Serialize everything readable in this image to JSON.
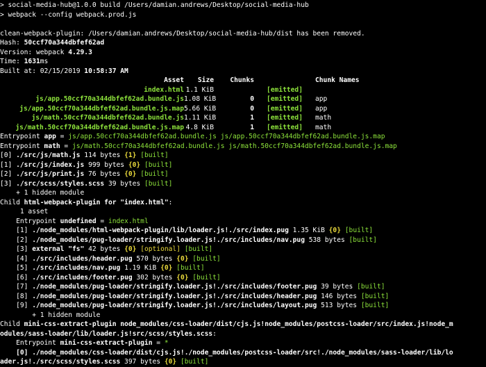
{
  "colors": {
    "background": "#000000",
    "text": "#ffffff",
    "green": "#8de33b",
    "yellow": "#e8d83b"
  },
  "header": [
    "> social-media-hub@1.0.0 build /Users/damian.andrews/Desktop/social-media-hub",
    "> webpack --config webpack.prod.js"
  ],
  "clean_line": "clean-webpack-plugin: /Users/damian.andrews/Desktop/social-media-hub/dist has been removed.",
  "hash_label": "Hash: ",
  "hash": "50ccf70a344dbfef62ad",
  "version_label": "Version: webpack ",
  "version": "4.29.3",
  "time_label": "Time: ",
  "time": "1631",
  "time_unit": "ms",
  "built_label": "Built at: 02/15/2019 ",
  "built_time": "10:58:37 AM",
  "table": {
    "headers": [
      "Asset",
      "Size",
      "Chunks",
      "",
      "Chunk Names"
    ],
    "rows": [
      {
        "asset": "index.html",
        "size": "1.1 KiB",
        "chunks": "",
        "status": "[emitted]",
        "name": ""
      },
      {
        "asset": "js/app.50ccf70a344dbfef62ad.bundle.js",
        "size": "1.08 KiB",
        "chunks": "0",
        "status": "[emitted]",
        "name": "app"
      },
      {
        "asset": "js/app.50ccf70a344dbfef62ad.bundle.js.map",
        "size": "5.66 KiB",
        "chunks": "0",
        "status": "[emitted]",
        "name": "app"
      },
      {
        "asset": "js/math.50ccf70a344dbfef62ad.bundle.js",
        "size": "1.11 KiB",
        "chunks": "1",
        "status": "[emitted]",
        "name": "math"
      },
      {
        "asset": "js/math.50ccf70a344dbfef62ad.bundle.js.map",
        "size": "4.8 KiB",
        "chunks": "1",
        "status": "[emitted]",
        "name": "math"
      }
    ]
  },
  "entrypoints": [
    {
      "label": "Entrypoint ",
      "name": "app",
      "eq": " = ",
      "files": "js/app.50ccf70a344dbfef62ad.bundle.js js/app.50ccf70a344dbfef62ad.bundle.js.map"
    },
    {
      "label": "Entrypoint ",
      "name": "math",
      "eq": " = ",
      "files": "js/math.50ccf70a344dbfef62ad.bundle.js js/math.50ccf70a344dbfef62ad.bundle.js.map"
    }
  ],
  "modules": [
    {
      "id": "[0] ",
      "path": "./src/js/math.js",
      "info": " 114 bytes ",
      "chunk": "{1}",
      "tag": "[built]"
    },
    {
      "id": "[1] ",
      "path": "./src/js/index.js",
      "info": " 999 bytes ",
      "chunk": "{0}",
      "tag": "[built]"
    },
    {
      "id": "[2] ",
      "path": "./src/js/print.js",
      "info": " 76 bytes ",
      "chunk": "{0}",
      "tag": "[built]"
    },
    {
      "id": "[3] ",
      "path": "./src/scss/styles.scss",
      "info": " 39 bytes ",
      "chunk": "",
      "tag": "[built]"
    }
  ],
  "hidden_module": "    + 1 hidden module",
  "child1": {
    "prefix": "Child ",
    "name": "html-webpack-plugin for \"index.html\"",
    "suffix": ":",
    "asset_count": "     1 asset",
    "entry_label": "    Entrypoint ",
    "entry_name": "undefined",
    "entry_eq": " = ",
    "entry_file": "index.html",
    "modules": [
      {
        "id": "    [1] ",
        "path": "./node_modules/html-webpack-plugin/lib/loader.js!./src/index.pug",
        "info": " 1.35 KiB ",
        "chunk": "{0}",
        "tag": "[built]",
        "tag2": ""
      },
      {
        "id": "    [2] ",
        "path": "./node_modules/pug-loader/stringify.loader.js!./src/includes/nav.pug",
        "info": " 538 bytes ",
        "chunk": "",
        "tag": "[built]",
        "tag2": ""
      },
      {
        "id": "    [3] ",
        "path": "external \"fs\"",
        "info": " 42 bytes ",
        "chunk": "{0}",
        "tag": "[optional]",
        "tag2": "[built]"
      },
      {
        "id": "    [4] ",
        "path": "./src/includes/header.pug",
        "info": " 570 bytes ",
        "chunk": "{0}",
        "tag": "[built]",
        "tag2": ""
      },
      {
        "id": "    [5] ",
        "path": "./src/includes/nav.pug",
        "info": " 1.19 KiB ",
        "chunk": "{0}",
        "tag": "[built]",
        "tag2": ""
      },
      {
        "id": "    [6] ",
        "path": "./src/includes/footer.pug",
        "info": " 302 bytes ",
        "chunk": "{0}",
        "tag": "[built]",
        "tag2": ""
      },
      {
        "id": "    [7] ",
        "path": "./node_modules/pug-loader/stringify.loader.js!./src/includes/footer.pug",
        "info": " 39 bytes ",
        "chunk": "",
        "tag": "[built]",
        "tag2": ""
      },
      {
        "id": "    [8] ",
        "path": "./node_modules/pug-loader/stringify.loader.js!./src/includes/header.pug",
        "info": " 146 bytes ",
        "chunk": "",
        "tag": "[built]",
        "tag2": ""
      },
      {
        "id": "    [9] ",
        "path": "./node_modules/pug-loader/stringify.loader.js!./src/includes/layout.pug",
        "info": " 513 bytes ",
        "chunk": "",
        "tag": "[built]",
        "tag2": ""
      }
    ],
    "hidden_module": "        + 1 hidden module"
  },
  "child2": {
    "prefix": "Child ",
    "name_line1": "mini-css-extract-plugin node_modules/css-loader/dist/cjs.js!node_modules/postcss-loader/src/index.js!node_m",
    "name_line2": "odules/sass-loader/lib/loader.js!src/scss/styles.scss",
    "suffix": ":",
    "entry_label": "    Entrypoint ",
    "entry_name": "mini-css-extract-plugin",
    "entry_eq": " = ",
    "entry_file": "*",
    "module_line1": "    [0] ./node_modules/css-loader/dist/cjs.js!./node_modules/postcss-loader/src!./node_modules/sass-loader/lib/lo",
    "module_line2_path": "ader.js!./src/scss/styles.scss",
    "module_line2_info": " 397 bytes ",
    "module_line2_chunk": "{0}",
    "module_line2_tag": "[built]"
  }
}
